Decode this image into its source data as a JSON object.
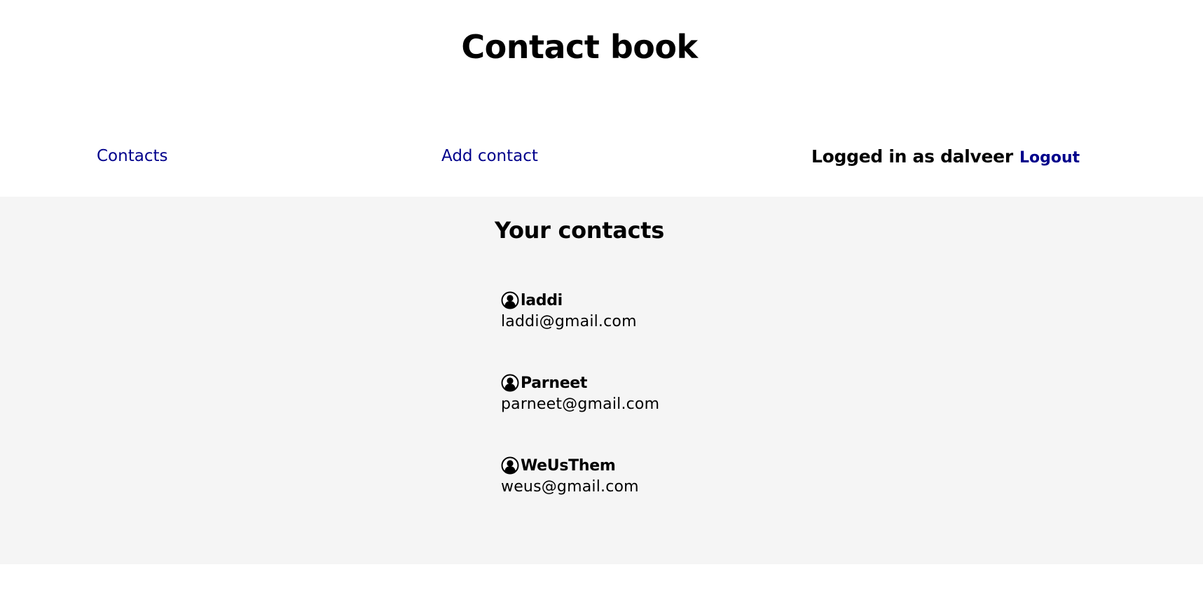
{
  "header": {
    "title": "Contact book",
    "nav": {
      "contacts_label": "Contacts",
      "add_contact_label": "Add contact"
    },
    "user": {
      "logged_in_text": "Logged in as dalveer",
      "logout_label": "Logout"
    }
  },
  "main": {
    "title": "Your contacts",
    "contacts": [
      {
        "name": "laddi",
        "email": "laddi@gmail.com",
        "icon": "user-avatar-icon"
      },
      {
        "name": "Parneet",
        "email": "parneet@gmail.com",
        "icon": "user-avatar-icon"
      },
      {
        "name": "WeUsThem",
        "email": "weus@gmail.com",
        "icon": "user-avatar-icon"
      }
    ]
  },
  "colors": {
    "link": "#00008b",
    "main_background": "#f5f5f5",
    "page_background": "#ffffff",
    "text": "#000000"
  }
}
